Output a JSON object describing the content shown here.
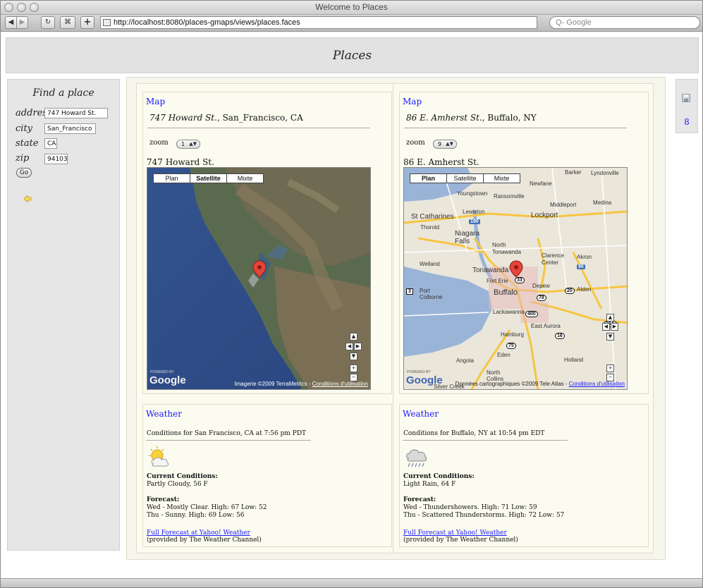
{
  "window": {
    "title": "Welcome to Places"
  },
  "toolbar": {
    "url": "http://localhost:8080/places-gmaps/views/places.faces",
    "search_placeholder": "Q- Google"
  },
  "page": {
    "title": "Places"
  },
  "find": {
    "title": "Find a place",
    "fields": [
      {
        "label": "address",
        "value": "747 Howard St."
      },
      {
        "label": "city",
        "value": "San_Francisco"
      },
      {
        "label": "state",
        "value": "CA"
      },
      {
        "label": "zip",
        "value": "94103"
      }
    ],
    "go_label": "Go"
  },
  "side": {
    "count": "8"
  },
  "places": [
    {
      "map_link": "Map",
      "street": "747 Howard St.",
      "city_state": ", San_Francisco, CA",
      "zoom_label": "zoom",
      "zoom_value": "1",
      "map_title": "747 Howard St.",
      "map_types": [
        "Plan",
        "Satellite",
        "Mixte"
      ],
      "map_type_selected": "Satellite",
      "powered_by": "POWERED BY",
      "google": "Google",
      "attribution_text": "Imagerie ©2009 TerraMetrics - ",
      "attribution_link": "Conditions d'utilisation",
      "weather_link": "Weather",
      "conditions_for": "Conditions for San Francisco, CA at 7:56 pm PDT",
      "current_label": "Current Conditions:",
      "current": "Partly Cloudy, 56 F",
      "forecast_label": "Forecast:",
      "forecast": [
        "Wed - Mostly Clear. High: 67 Low: 52",
        "Thu - Sunny. High: 69 Low: 56"
      ],
      "full_forecast": "Full Forecast at Yahoo! Weather",
      "provided_by": "(provided by The Weather Channel)",
      "icon": "partly-cloudy-icon"
    },
    {
      "map_link": "Map",
      "street": "86 E. Amherst St.",
      "city_state": ", Buffalo, NY",
      "zoom_label": "zoom",
      "zoom_value": "9",
      "map_title": "86 E. Amherst St.",
      "map_types": [
        "Plan",
        "Satellite",
        "Mixte"
      ],
      "map_type_selected": "Plan",
      "powered_by": "POWERED BY",
      "google": "Google",
      "attribution_text": "Données cartographiques ©2009 Tele Atlas - ",
      "attribution_link": "Conditions d'utilisation",
      "map_labels": [
        "Barker",
        "Lyndonville",
        "Newfane",
        "Youngstown",
        "Ransomville",
        "Middleport",
        "Medina",
        "Lewiston",
        "Lockport",
        "St Catharines",
        "Thorold",
        "Niagara Falls",
        "North Tonawanda",
        "Clarence Center",
        "Akron",
        "Welland",
        "Tonawanda",
        "Fort Erie",
        "Depew",
        "Alden",
        "Port Colborne",
        "Buffalo",
        "Lackawanna",
        "East Aurora",
        "Hamburg",
        "Eden",
        "Angola",
        "Holland",
        "North Collins",
        "Silver Creek"
      ],
      "road_shields": [
        "190",
        "33",
        "90",
        "20",
        "78",
        "400",
        "20A",
        "75",
        "16",
        "3"
      ],
      "weather_link": "Weather",
      "conditions_for": "Conditions for Buffalo, NY at 10:54 pm EDT",
      "current_label": "Current Conditions:",
      "current": "Light Rain, 64 F",
      "forecast_label": "Forecast:",
      "forecast": [
        "Wed - Thundershowers. High: 71 Low: 59",
        "Thu - Scattered Thunderstorms. High: 72 Low: 57"
      ],
      "full_forecast": "Full Forecast at Yahoo! Weather",
      "provided_by": "(provided by The Weather Channel)",
      "icon": "light-rain-icon"
    }
  ]
}
